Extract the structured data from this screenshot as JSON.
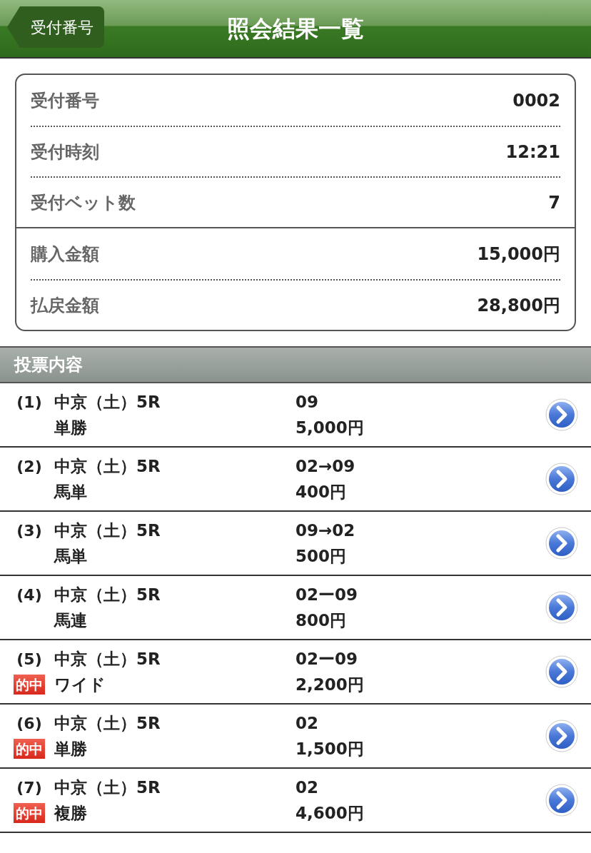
{
  "header": {
    "back_button": "受付番号",
    "title": "照会結果一覧"
  },
  "summary": [
    [
      {
        "label": "受付番号",
        "value": "0002"
      },
      {
        "label": "受付時刻",
        "value": "12:21"
      },
      {
        "label": "受付ベット数",
        "value": "7"
      }
    ],
    [
      {
        "label": "購入金額",
        "value": "15,000円"
      },
      {
        "label": "払戻金額",
        "value": "28,800円"
      }
    ]
  ],
  "section_title": "投票内容",
  "bets": [
    {
      "no": "(1)",
      "race": "中京（土）5R",
      "type": "単勝",
      "numbers": "09",
      "amount": "5,000円"
    },
    {
      "no": "(2)",
      "race": "中京（土）5R",
      "type": "馬単",
      "numbers": "02→09",
      "amount": "400円"
    },
    {
      "no": "(3)",
      "race": "中京（土）5R",
      "type": "馬単",
      "numbers": "09→02",
      "amount": "500円"
    },
    {
      "no": "(4)",
      "race": "中京（土）5R",
      "type": "馬連",
      "numbers": "02ー09",
      "amount": "800円"
    },
    {
      "no": "(5)",
      "badge": "的中",
      "race": "中京（土）5R",
      "type": "ワイド",
      "numbers": "02ー09",
      "amount": "2,200円"
    },
    {
      "no": "(6)",
      "badge": "的中",
      "race": "中京（土）5R",
      "type": "単勝",
      "numbers": "02",
      "amount": "1,500円"
    },
    {
      "no": "(7)",
      "badge": "的中",
      "race": "中京（土）5R",
      "type": "複勝",
      "numbers": "02",
      "amount": "4,600円"
    }
  ]
}
